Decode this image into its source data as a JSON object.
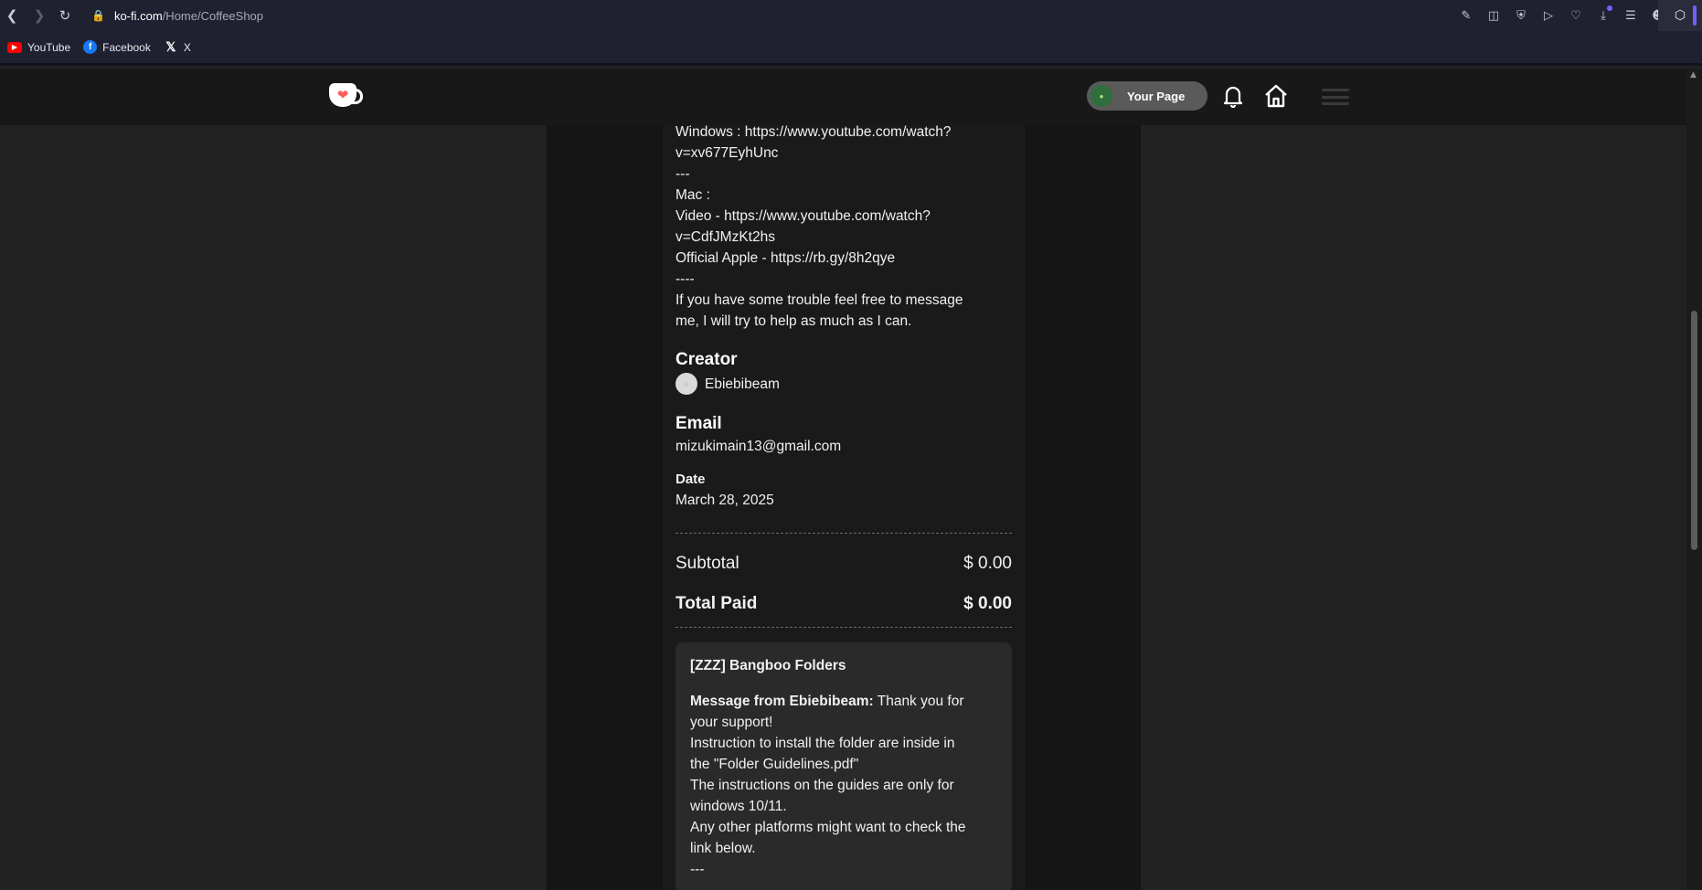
{
  "browser": {
    "url_host": "ko-fi.com",
    "url_path": "/Home/CoffeeShop",
    "bookmarks": [
      "YouTube",
      "Facebook",
      "X"
    ]
  },
  "header": {
    "your_page_label": "Your Page"
  },
  "description": {
    "lines": [
      "Windows : https://www.youtube.com/watch?",
      "v=xv677EyhUnc",
      "---",
      "Mac :",
      "Video - https://www.youtube.com/watch?",
      "v=CdfJMzKt2hs",
      "Official Apple - https://rb.gy/8h2qye",
      "----",
      "If you have some trouble feel free to message",
      "me, I will try to help as much as I can."
    ]
  },
  "creator": {
    "title": "Creator",
    "name": "Ebiebibeam"
  },
  "email": {
    "title": "Email",
    "value": "mizukimain13@gmail.com"
  },
  "date": {
    "title": "Date",
    "value": "March 28, 2025"
  },
  "totals": {
    "subtotal_label": "Subtotal",
    "subtotal_value": "$ 0.00",
    "total_label": "Total Paid",
    "total_value": "$ 0.00"
  },
  "message": {
    "title": "[ZZZ] Bangboo Folders",
    "from_label": "Message from Ebiebibeam:",
    "first_text": " Thank you for",
    "lines": [
      "your support!",
      "Instruction to install the folder are inside in",
      "the \"Folder Guidelines.pdf\"",
      "The instructions on the guides are only for",
      "windows 10/11.",
      "Any other platforms might want to check the",
      "link below.",
      "---"
    ]
  }
}
